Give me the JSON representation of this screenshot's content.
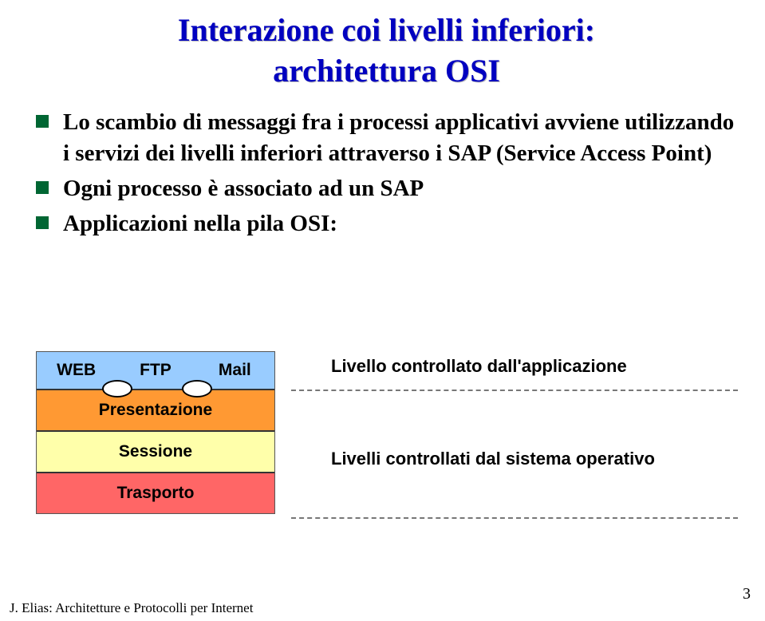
{
  "title": {
    "line1": "Interazione coi livelli inferiori:",
    "line2": "architettura OSI"
  },
  "bullets": [
    "Lo scambio di messaggi fra i processi applicativi avviene utilizzando i servizi dei livelli inferiori attraverso i SAP (Service Access Point)",
    "Ogni processo è associato ad un  SAP",
    "Applicazioni nella pila OSI:"
  ],
  "stack": {
    "top": [
      "WEB",
      "FTP",
      "Mail"
    ],
    "layers": [
      {
        "name": "Presentazione",
        "class": "pres"
      },
      {
        "name": "Sessione",
        "class": "sess"
      },
      {
        "name": "Trasporto",
        "class": "tras"
      }
    ]
  },
  "rightLabels": {
    "app": "Livello controllato dall'applicazione",
    "os": "Livelli controllati dal sistema operativo"
  },
  "footer": "J. Elias: Architetture e Protocolli per Internet",
  "pageNumber": "3",
  "chart_data": {
    "type": "table",
    "title": "Applicazioni nella pila OSI",
    "rows": [
      [
        "WEB",
        "FTP",
        "Mail"
      ],
      [
        "Presentazione"
      ],
      [
        "Sessione"
      ],
      [
        "Trasporto"
      ]
    ],
    "annotations": {
      "application_controlled": "Livello controllato dall'applicazione (WEB/FTP/Mail row)",
      "os_controlled": "Livelli controllati dal sistema operativo (Presentazione, Sessione, Trasporto)"
    }
  }
}
